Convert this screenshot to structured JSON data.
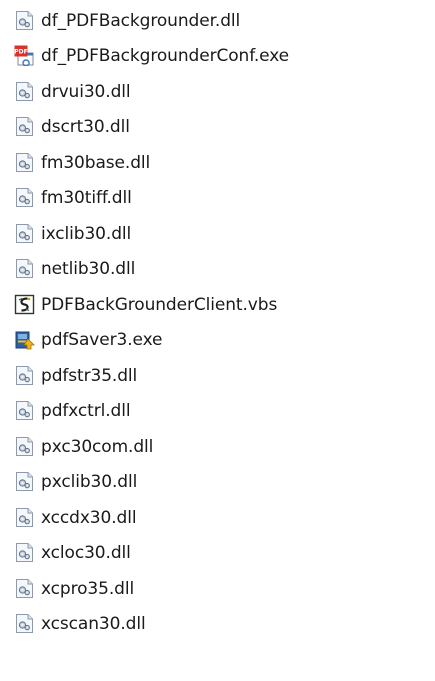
{
  "explorer": {
    "files": [
      {
        "name": "df_PDFBackgrounder.dll",
        "icon": "dll-icon"
      },
      {
        "name": "df_PDFBackgrounderConf.exe",
        "icon": "pdf-exe-icon"
      },
      {
        "name": "drvui30.dll",
        "icon": "dll-icon"
      },
      {
        "name": "dscrt30.dll",
        "icon": "dll-icon"
      },
      {
        "name": "fm30base.dll",
        "icon": "dll-icon"
      },
      {
        "name": "fm30tiff.dll",
        "icon": "dll-icon"
      },
      {
        "name": "ixclib30.dll",
        "icon": "dll-icon"
      },
      {
        "name": "netlib30.dll",
        "icon": "dll-icon"
      },
      {
        "name": "PDFBackGrounderClient.vbs",
        "icon": "vbs-script-icon"
      },
      {
        "name": "pdfSaver3.exe",
        "icon": "installer-exe-icon"
      },
      {
        "name": "pdfstr35.dll",
        "icon": "dll-icon"
      },
      {
        "name": "pdfxctrl.dll",
        "icon": "dll-icon"
      },
      {
        "name": "pxc30com.dll",
        "icon": "dll-icon"
      },
      {
        "name": "pxclib30.dll",
        "icon": "dll-icon"
      },
      {
        "name": "xccdx30.dll",
        "icon": "dll-icon"
      },
      {
        "name": "xcloc30.dll",
        "icon": "dll-icon"
      },
      {
        "name": "xcpro35.dll",
        "icon": "dll-icon"
      },
      {
        "name": "xcscan30.dll",
        "icon": "dll-icon"
      }
    ]
  }
}
